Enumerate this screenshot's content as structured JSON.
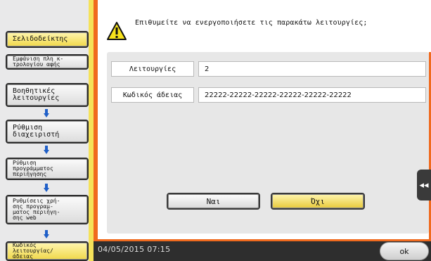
{
  "sidebar": {
    "items": [
      {
        "label": "Σελιδοδείκτης"
      },
      {
        "label": "Εμφάνιση πλη κ-\nτρολογίου αφής"
      },
      {
        "label": "Βοηθητικές\nλειτουργίες"
      },
      {
        "label": "Ρύθμιση\nδιαχειριστή"
      },
      {
        "label": "Ρύθμιση\nπρογράμματος\nπεριήγησης"
      },
      {
        "label": "Ρυθμίσεις χρή-\nσης προγραμ-\nματος περιήγη-\nσης web"
      },
      {
        "label": "Κωδικός\nλειτουργίας/\nάδειας"
      }
    ]
  },
  "dialog": {
    "message": "Επιθυμείτε να ενεργοποιήσετε τις παρακάτω λειτουργίες;",
    "fields": [
      {
        "label": "Λειτουργίες",
        "value": "2"
      },
      {
        "label": "Κωδικός άδειας",
        "value": "22222-22222-22222-22222-22222-22222"
      }
    ],
    "yes_label": "Ναι",
    "no_label": "Όχι",
    "collapse_glyph": "◂◂"
  },
  "status": {
    "datetime": "04/05/2015  07:15",
    "ok_label": "ok"
  },
  "colors": {
    "accent": "#f06a1e",
    "selected": "#f0d84a"
  }
}
